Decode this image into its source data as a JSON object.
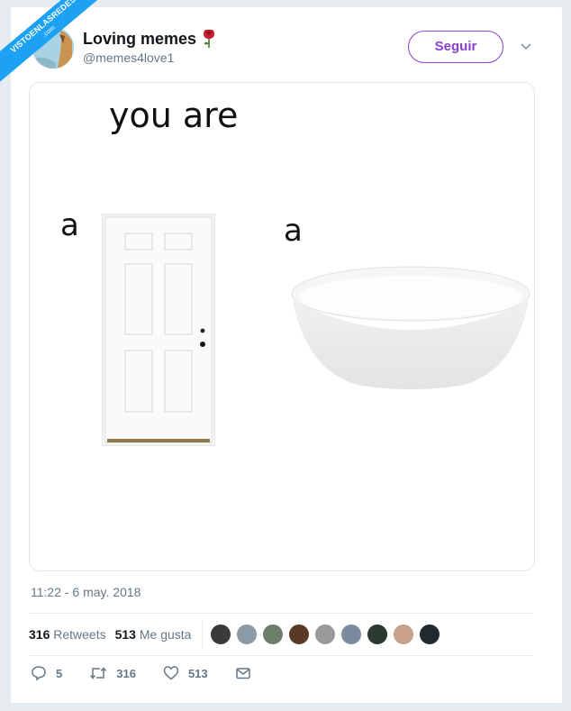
{
  "watermark": {
    "line1": "VISTOENLASREDES",
    "line2": ".com"
  },
  "author": {
    "name": "Loving memes",
    "handle": "@memes4love1"
  },
  "follow_label": "Seguir",
  "meme": {
    "title": "you are",
    "label_left": "a",
    "label_right": "a"
  },
  "timestamp": "11:22 - 6 may. 2018",
  "stats": {
    "retweets_count": "316",
    "retweets_label": "Retweets",
    "likes_count": "513",
    "likes_label": "Me gusta"
  },
  "likers": [
    "#3a3a3a",
    "#8a9aa6",
    "#6d7f6a",
    "#5a3a24",
    "#9a9a9a",
    "#7b8a9c",
    "#2b3a2f",
    "#c9a08a",
    "#1f2a33"
  ],
  "actions": {
    "replies": "5",
    "retweets": "316",
    "likes": "513"
  },
  "colors": {
    "accent": "#8a3fd1",
    "secondary_text": "#657786",
    "watermark": "#1da1f2"
  }
}
